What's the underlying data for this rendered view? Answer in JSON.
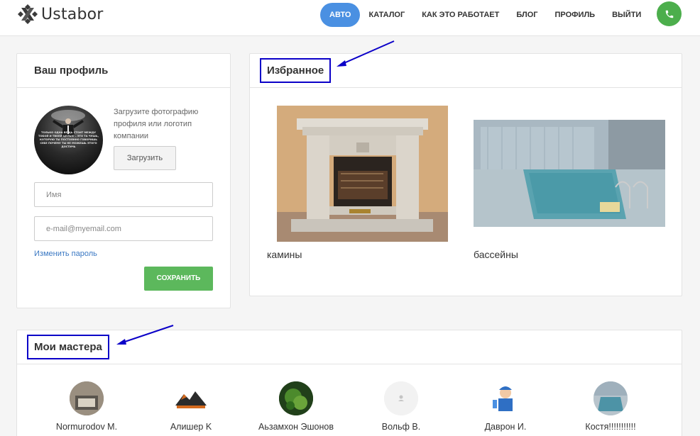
{
  "brand": {
    "name": "Ustabor"
  },
  "nav": {
    "items": [
      {
        "label": "АВТО"
      },
      {
        "label": "КАТАЛОГ"
      },
      {
        "label": "КАК ЭТО РАБОТАЕТ"
      },
      {
        "label": "БЛОГ"
      },
      {
        "label": "ПРОФИЛЬ"
      },
      {
        "label": "ВЫЙТИ"
      }
    ],
    "phone_icon": "phone-icon",
    "accent": "#4a90e2",
    "phone_color": "#4cae4c"
  },
  "profile": {
    "title": "Ваш профиль",
    "upload_hint": "Загрузите фотографию профиля или логотип компании",
    "upload_label": "Загрузить",
    "name_placeholder": "Имя",
    "email_placeholder": "e-mail@myemail.com",
    "change_password": "Изменить пароль",
    "save_label": "СОХРАНИТЬ",
    "save_color": "#5cb85c",
    "avatar_caption": "ТОЛЬКО ОДНА ВЕЩЬ СТОИТ МЕЖДУ ТОБОЙ И ТВОЕЙ ЦЕЛЬЮ – ЭТО ТА ЧУШЬ, КОТОРУЮ ТЫ ПОСТОЯННО ГОВОРИШЬ СЕБЕ ПОЧЕМУ ТЫ НЕ МОЖЕШЬ ЭТОГО ДОСТИЧЬ"
  },
  "favorites": {
    "title": "Избранное",
    "items": [
      {
        "label": "камины"
      },
      {
        "label": "бассейны"
      }
    ]
  },
  "masters": {
    "title": "Мои мастера",
    "items": [
      {
        "name": "Normurodov M."
      },
      {
        "name": "Алишер K"
      },
      {
        "name": "Аьзамхон Эшонов"
      },
      {
        "name": "Вольф В."
      },
      {
        "name": "Даврон И."
      },
      {
        "name": "Костя!!!!!!!!!!!"
      }
    ]
  },
  "annotation_color": "#0b00c8"
}
